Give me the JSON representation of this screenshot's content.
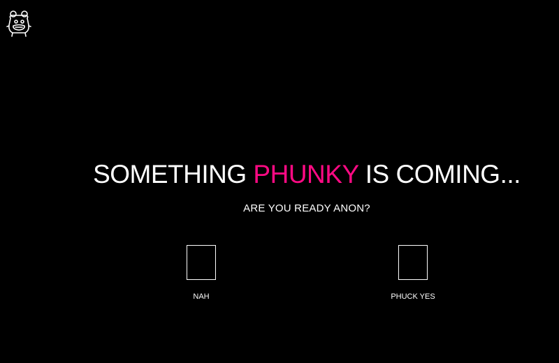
{
  "logo": {
    "icon": "phunky-bear-logo-icon"
  },
  "headline": {
    "before": "SOMETHING",
    "accent": "PHUNKY",
    "after": "IS COMING...",
    "accent_color": "#ff0a84"
  },
  "subtitle": "ARE YOU READY ANON?",
  "choices": [
    {
      "label": "NAH",
      "checked": false
    },
    {
      "label": "PHUCK YES",
      "checked": false
    }
  ],
  "colors": {
    "background": "#000000",
    "text": "#ffffff",
    "accent": "#ff0a84"
  }
}
